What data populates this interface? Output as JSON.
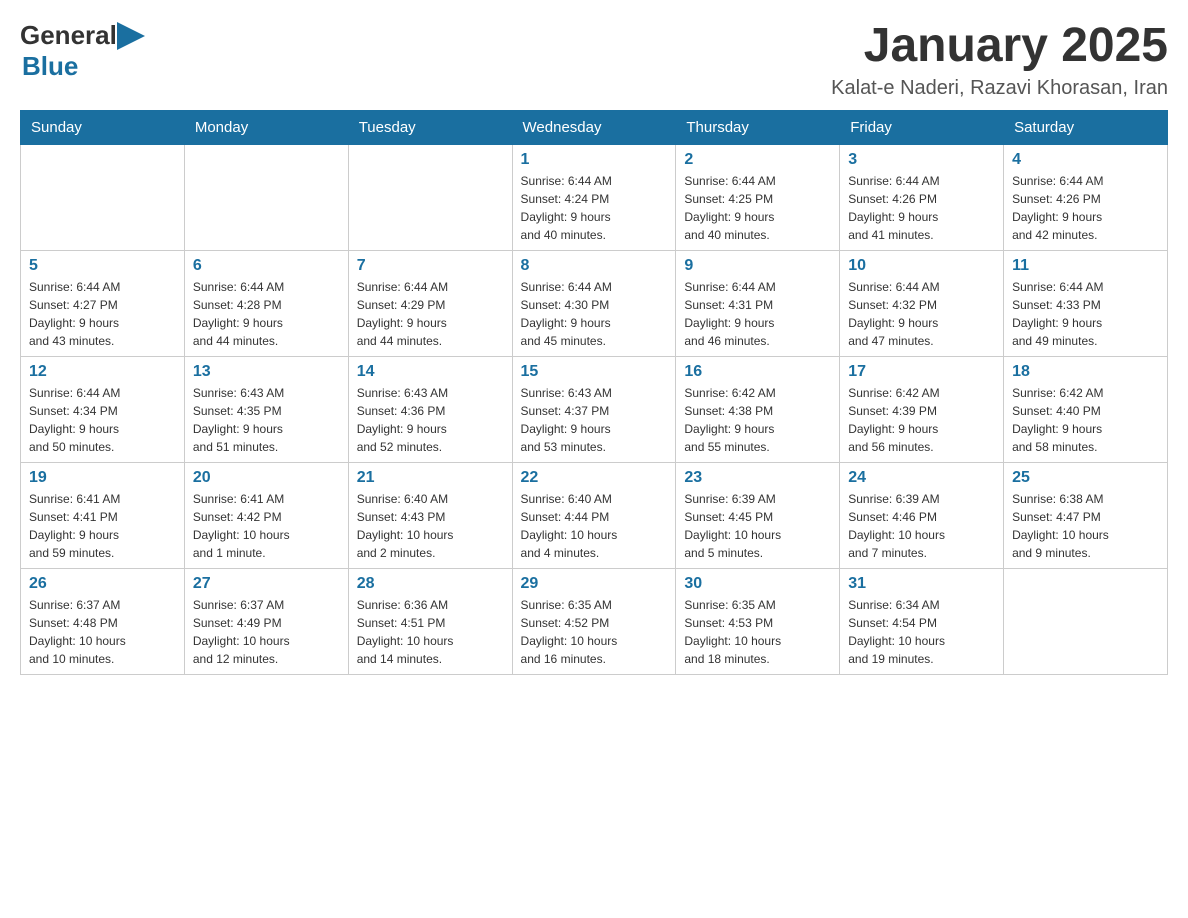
{
  "header": {
    "logo_general": "General",
    "logo_blue": "Blue",
    "month_title": "January 2025",
    "location": "Kalat-e Naderi, Razavi Khorasan, Iran"
  },
  "weekdays": [
    "Sunday",
    "Monday",
    "Tuesday",
    "Wednesday",
    "Thursday",
    "Friday",
    "Saturday"
  ],
  "weeks": [
    [
      {
        "day": "",
        "info": ""
      },
      {
        "day": "",
        "info": ""
      },
      {
        "day": "",
        "info": ""
      },
      {
        "day": "1",
        "info": "Sunrise: 6:44 AM\nSunset: 4:24 PM\nDaylight: 9 hours\nand 40 minutes."
      },
      {
        "day": "2",
        "info": "Sunrise: 6:44 AM\nSunset: 4:25 PM\nDaylight: 9 hours\nand 40 minutes."
      },
      {
        "day": "3",
        "info": "Sunrise: 6:44 AM\nSunset: 4:26 PM\nDaylight: 9 hours\nand 41 minutes."
      },
      {
        "day": "4",
        "info": "Sunrise: 6:44 AM\nSunset: 4:26 PM\nDaylight: 9 hours\nand 42 minutes."
      }
    ],
    [
      {
        "day": "5",
        "info": "Sunrise: 6:44 AM\nSunset: 4:27 PM\nDaylight: 9 hours\nand 43 minutes."
      },
      {
        "day": "6",
        "info": "Sunrise: 6:44 AM\nSunset: 4:28 PM\nDaylight: 9 hours\nand 44 minutes."
      },
      {
        "day": "7",
        "info": "Sunrise: 6:44 AM\nSunset: 4:29 PM\nDaylight: 9 hours\nand 44 minutes."
      },
      {
        "day": "8",
        "info": "Sunrise: 6:44 AM\nSunset: 4:30 PM\nDaylight: 9 hours\nand 45 minutes."
      },
      {
        "day": "9",
        "info": "Sunrise: 6:44 AM\nSunset: 4:31 PM\nDaylight: 9 hours\nand 46 minutes."
      },
      {
        "day": "10",
        "info": "Sunrise: 6:44 AM\nSunset: 4:32 PM\nDaylight: 9 hours\nand 47 minutes."
      },
      {
        "day": "11",
        "info": "Sunrise: 6:44 AM\nSunset: 4:33 PM\nDaylight: 9 hours\nand 49 minutes."
      }
    ],
    [
      {
        "day": "12",
        "info": "Sunrise: 6:44 AM\nSunset: 4:34 PM\nDaylight: 9 hours\nand 50 minutes."
      },
      {
        "day": "13",
        "info": "Sunrise: 6:43 AM\nSunset: 4:35 PM\nDaylight: 9 hours\nand 51 minutes."
      },
      {
        "day": "14",
        "info": "Sunrise: 6:43 AM\nSunset: 4:36 PM\nDaylight: 9 hours\nand 52 minutes."
      },
      {
        "day": "15",
        "info": "Sunrise: 6:43 AM\nSunset: 4:37 PM\nDaylight: 9 hours\nand 53 minutes."
      },
      {
        "day": "16",
        "info": "Sunrise: 6:42 AM\nSunset: 4:38 PM\nDaylight: 9 hours\nand 55 minutes."
      },
      {
        "day": "17",
        "info": "Sunrise: 6:42 AM\nSunset: 4:39 PM\nDaylight: 9 hours\nand 56 minutes."
      },
      {
        "day": "18",
        "info": "Sunrise: 6:42 AM\nSunset: 4:40 PM\nDaylight: 9 hours\nand 58 minutes."
      }
    ],
    [
      {
        "day": "19",
        "info": "Sunrise: 6:41 AM\nSunset: 4:41 PM\nDaylight: 9 hours\nand 59 minutes."
      },
      {
        "day": "20",
        "info": "Sunrise: 6:41 AM\nSunset: 4:42 PM\nDaylight: 10 hours\nand 1 minute."
      },
      {
        "day": "21",
        "info": "Sunrise: 6:40 AM\nSunset: 4:43 PM\nDaylight: 10 hours\nand 2 minutes."
      },
      {
        "day": "22",
        "info": "Sunrise: 6:40 AM\nSunset: 4:44 PM\nDaylight: 10 hours\nand 4 minutes."
      },
      {
        "day": "23",
        "info": "Sunrise: 6:39 AM\nSunset: 4:45 PM\nDaylight: 10 hours\nand 5 minutes."
      },
      {
        "day": "24",
        "info": "Sunrise: 6:39 AM\nSunset: 4:46 PM\nDaylight: 10 hours\nand 7 minutes."
      },
      {
        "day": "25",
        "info": "Sunrise: 6:38 AM\nSunset: 4:47 PM\nDaylight: 10 hours\nand 9 minutes."
      }
    ],
    [
      {
        "day": "26",
        "info": "Sunrise: 6:37 AM\nSunset: 4:48 PM\nDaylight: 10 hours\nand 10 minutes."
      },
      {
        "day": "27",
        "info": "Sunrise: 6:37 AM\nSunset: 4:49 PM\nDaylight: 10 hours\nand 12 minutes."
      },
      {
        "day": "28",
        "info": "Sunrise: 6:36 AM\nSunset: 4:51 PM\nDaylight: 10 hours\nand 14 minutes."
      },
      {
        "day": "29",
        "info": "Sunrise: 6:35 AM\nSunset: 4:52 PM\nDaylight: 10 hours\nand 16 minutes."
      },
      {
        "day": "30",
        "info": "Sunrise: 6:35 AM\nSunset: 4:53 PM\nDaylight: 10 hours\nand 18 minutes."
      },
      {
        "day": "31",
        "info": "Sunrise: 6:34 AM\nSunset: 4:54 PM\nDaylight: 10 hours\nand 19 minutes."
      },
      {
        "day": "",
        "info": ""
      }
    ]
  ]
}
